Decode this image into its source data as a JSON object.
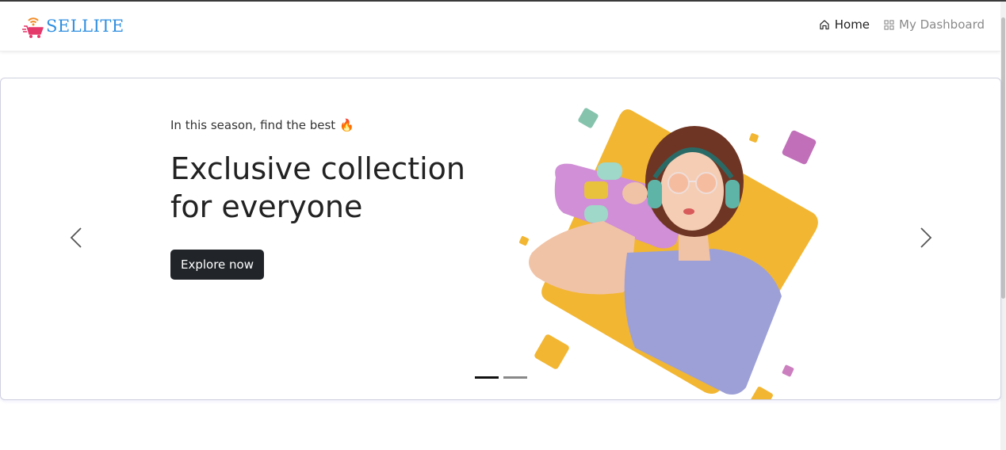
{
  "brand": {
    "name": "SELLITE",
    "logo_icon": "shopping-cart-wifi-icon"
  },
  "nav": {
    "home": {
      "label": "Home",
      "icon": "home-icon"
    },
    "dashboard": {
      "label": "My Dashboard",
      "icon": "grid-icon"
    }
  },
  "hero": {
    "tagline": "In this season, find the best 🔥",
    "headline": "Exclusive collection for everyone",
    "cta_label": "Explore now",
    "prev_icon": "chevron-left-icon",
    "next_icon": "chevron-right-icon",
    "slide_count": 2,
    "active_slide": 1
  },
  "colors": {
    "brand_text": "#2f8fe0",
    "cta_bg": "#212529",
    "accent_yellow": "#f2b632",
    "accent_purple": "#9da0d6"
  }
}
